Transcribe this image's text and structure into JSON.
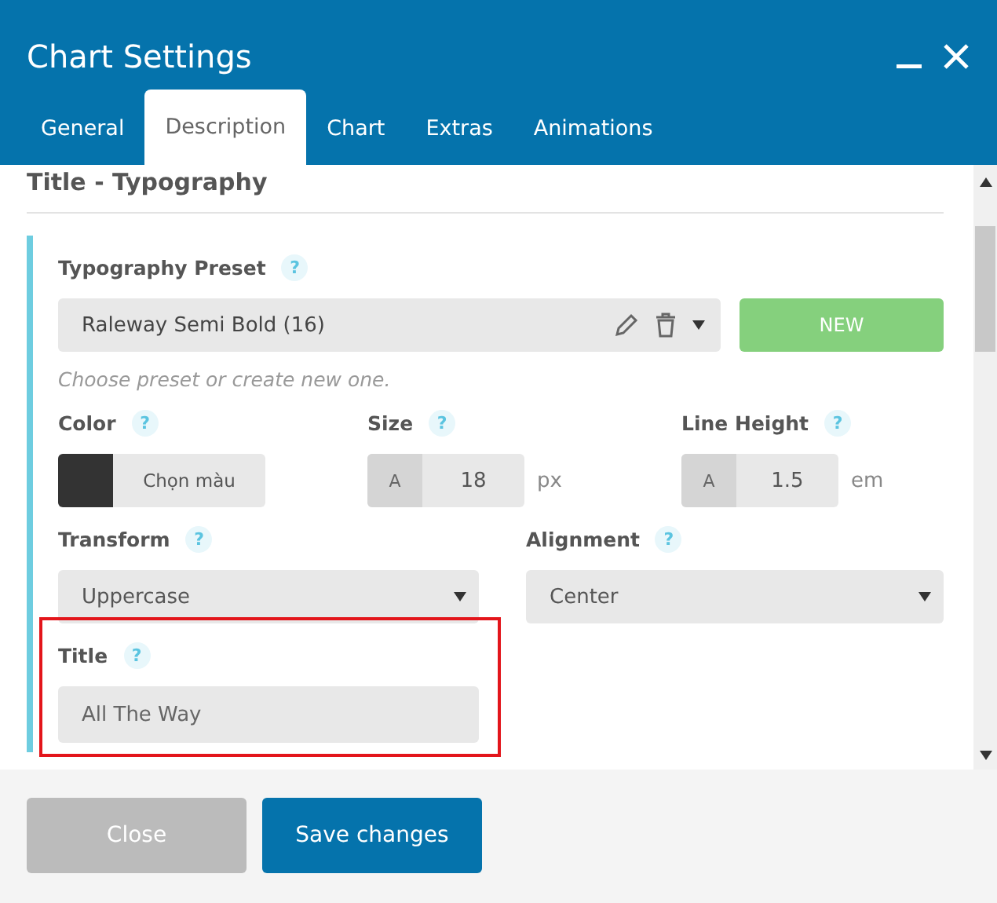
{
  "window": {
    "title": "Chart Settings"
  },
  "tabs": [
    {
      "label": "General",
      "selected": false
    },
    {
      "label": "Description",
      "selected": true
    },
    {
      "label": "Chart",
      "selected": false
    },
    {
      "label": "Extras",
      "selected": false
    },
    {
      "label": "Animations",
      "selected": false
    }
  ],
  "section": {
    "title": "Title - Typography"
  },
  "preset": {
    "label": "Typography Preset",
    "help": "?",
    "value": "Raleway Semi Bold (16)",
    "new_button": "NEW",
    "hint": "Choose preset or create new one."
  },
  "rows": [
    [
      {
        "kind": "color",
        "label": "Color",
        "help": "?",
        "color": "#333333",
        "button": "Chọn màu",
        "highlighted": false
      },
      {
        "kind": "number",
        "label": "Size",
        "help": "?",
        "prefix": "A",
        "value": "18",
        "unit": "px",
        "highlighted": false
      },
      {
        "kind": "number",
        "label": "Line Height",
        "help": "?",
        "prefix": "A",
        "value": "1.5",
        "unit": "em",
        "highlighted": false
      }
    ],
    [
      {
        "kind": "select",
        "label": "Transform",
        "help": "?",
        "value": "Uppercase",
        "highlighted": false
      },
      {
        "kind": "select",
        "label": "Alignment",
        "help": "?",
        "value": "Center",
        "highlighted": false
      }
    ],
    [
      {
        "kind": "text",
        "label": "Title",
        "help": "?",
        "value": "All The Way",
        "highlighted": true
      }
    ]
  ],
  "footer": {
    "buttons": [
      {
        "label": "Close",
        "kind": "secondary"
      },
      {
        "label": "Save changes",
        "kind": "primary"
      }
    ]
  }
}
